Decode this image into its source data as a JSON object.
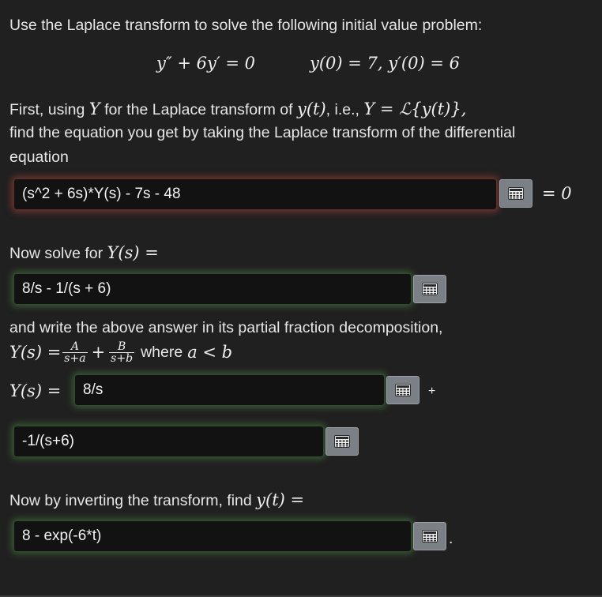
{
  "intro": {
    "instruction": "Use the Laplace transform to solve the following initial value problem:",
    "ode": "y″ + 6y′ = 0",
    "initial_conditions": "y(0) = 7,  y′(0) = 6"
  },
  "step1": {
    "line1_pre": "First, using ",
    "line1_Y": "Y",
    "line1_mid": " for the Laplace transform of ",
    "line1_yt": "y(t)",
    "line1_ie": ", i.e., ",
    "line1_def": "Y = ℒ{y(t)},",
    "line2": "find the equation you get by taking the Laplace transform of the differential",
    "line3": "equation",
    "answer": "(s^2 + 6s)*Y(s) - 7s - 48",
    "eq_zero": "= 0",
    "status": "incorrect"
  },
  "step2": {
    "prompt": "Now solve for ",
    "Ys": "Y(s) =",
    "answer": "8/s - 1/(s + 6)",
    "status": "correct"
  },
  "step3": {
    "prompt": "and write the above answer in its partial fraction decomposition,",
    "Ys": "Y(s) =",
    "fracA_num": "A",
    "fracA_den": "s+a",
    "plus": "+",
    "fracB_num": "B",
    "fracB_den": "s+b",
    "where": "where",
    "condition": "a < b",
    "Ys_label": "Y(s) =",
    "answer1": "8/s",
    "plus_sign": "+",
    "answer2": "-1/(s+6)",
    "status": "correct"
  },
  "step4": {
    "prompt": "Now by inverting the transform, find ",
    "yt": "y(t) =",
    "answer": "8 - exp(-6*t)",
    "period": ".",
    "status": "correct"
  },
  "icons": {
    "palette": "math-palette-icon"
  },
  "colors": {
    "background": "#202020",
    "error_glow": "#c44a40",
    "correct_glow": "#529248",
    "input_bg": "#121212",
    "palette_button": "#7b7f86"
  }
}
